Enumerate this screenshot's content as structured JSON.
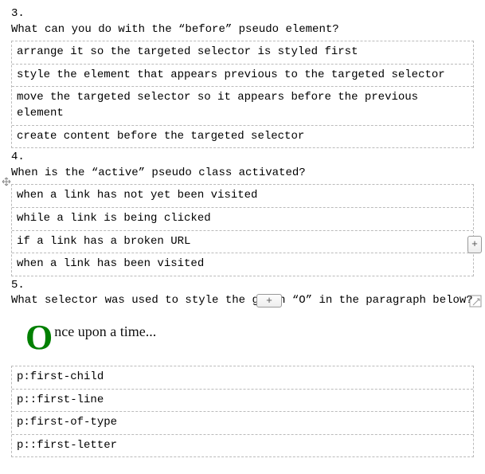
{
  "q3": {
    "num": "3.",
    "text": "What can you do with the “before” pseudo element?",
    "answers": [
      "arrange it so the targeted selector is styled first",
      "style the element that appears previous to the targeted selector",
      "move the targeted selector so it appears before the previous element",
      "create content before the targeted selector"
    ]
  },
  "q4": {
    "num": "4.",
    "text": "When is the “active” pseudo class activated?",
    "answers": [
      "when a link has not yet been visited",
      "while a link is being clicked",
      "if a link has a broken URL",
      "when a link has been visited"
    ]
  },
  "q5": {
    "num": "5.",
    "text": "What selector was used to style the green “O” in the paragraph below?",
    "example_drop": "O",
    "example_rest": "nce upon a time...",
    "answers": [
      "p:first-child",
      "p::first-line",
      "p:first-of-type",
      "p::first-letter"
    ]
  },
  "ui": {
    "plus": "+"
  }
}
